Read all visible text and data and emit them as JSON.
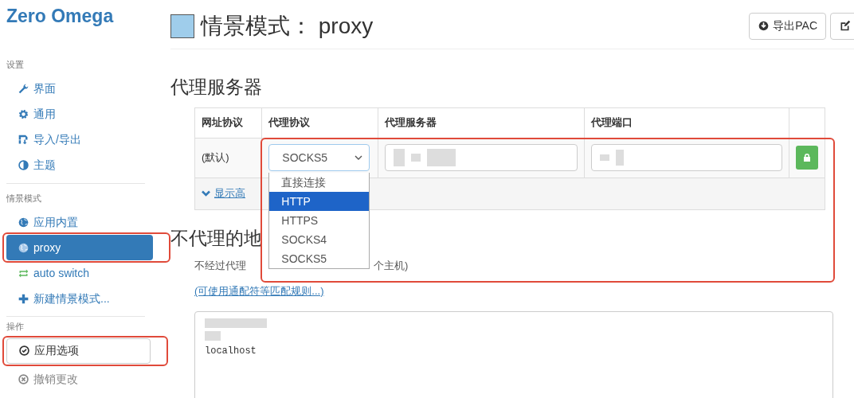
{
  "sidebar": {
    "title": "Zero Omega",
    "sections": [
      {
        "header": "设置",
        "items": [
          {
            "label": "界面",
            "selected": false,
            "highlighted": false
          },
          {
            "label": "通用",
            "selected": false,
            "highlighted": false
          },
          {
            "label": "导入/导出",
            "selected": false,
            "highlighted": false
          },
          {
            "label": "主题",
            "selected": false,
            "highlighted": false
          }
        ]
      },
      {
        "header": "情景模式",
        "items": [
          {
            "label": "应用内置",
            "selected": false,
            "highlighted": false
          },
          {
            "label": "proxy",
            "selected": true,
            "highlighted": true
          },
          {
            "label": "auto switch",
            "selected": false,
            "highlighted": false
          },
          {
            "label": "新建情景模式...",
            "selected": false,
            "highlighted": false
          }
        ]
      }
    ],
    "actions": {
      "header": "操作",
      "items": [
        {
          "label": "应用选项",
          "disabled": false,
          "highlighted": true
        },
        {
          "label": "撤销更改",
          "disabled": true,
          "highlighted": false
        }
      ]
    }
  },
  "page": {
    "title_prefix": "情景模式：",
    "profile_name": "proxy",
    "export_button": "导出PAC"
  },
  "proxy_servers": {
    "title": "代理服务器",
    "highlighted": true,
    "columns": [
      "网址协议",
      "代理协议",
      "代理服务器",
      "代理端口"
    ],
    "rows": [
      {
        "scheme": "(默认)",
        "protocol": "SOCKS5",
        "server_redacted": true,
        "port_redacted": true,
        "locked": true
      }
    ],
    "dropdown": {
      "open": true,
      "options": [
        {
          "label": "直接连接",
          "selected": false
        },
        {
          "label": "HTTP",
          "selected": true
        },
        {
          "label": "HTTPS",
          "selected": false
        },
        {
          "label": "SOCKS4",
          "selected": false
        },
        {
          "label": "SOCKS5",
          "selected": false
        }
      ]
    },
    "advanced_link": "显示高"
  },
  "bypass": {
    "title": "不代理的地",
    "description": [
      "不经过代理",
      "个主机)"
    ],
    "rules_link": "(可使用通配符等匹配规则...)",
    "lines": [
      {
        "kind": "redacted"
      },
      {
        "kind": "redacted"
      },
      {
        "kind": "text",
        "text": "localhost"
      }
    ]
  }
}
